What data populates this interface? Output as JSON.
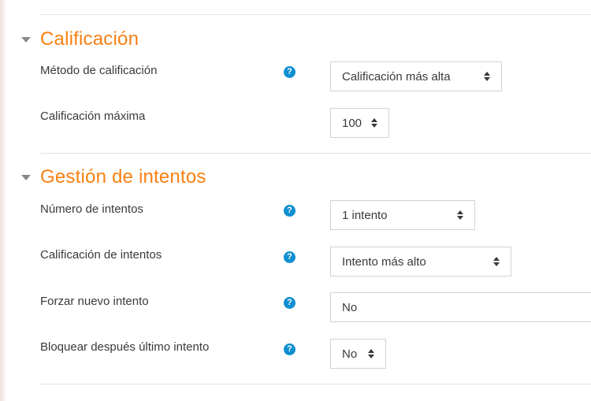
{
  "sections": [
    {
      "title": "Calificación",
      "fields": [
        {
          "label": "Método de calificación",
          "value": "Calificación más alta",
          "has_help": true
        },
        {
          "label": "Calificación máxima",
          "value": "100",
          "has_help": false
        }
      ]
    },
    {
      "title": "Gestión de intentos",
      "fields": [
        {
          "label": "Número de intentos",
          "value": "1 intento",
          "has_help": true
        },
        {
          "label": "Calificación de intentos",
          "value": "Intento más alto",
          "has_help": true
        },
        {
          "label": "Forzar nuevo intento",
          "value": "No",
          "has_help": true
        },
        {
          "label": "Bloquear después último intento",
          "value": "No",
          "has_help": true
        }
      ]
    }
  ],
  "help_icon_glyph": "?",
  "colors": {
    "section_title": "#f98012",
    "help_icon": "#0f8fd0",
    "text": "#373a3c",
    "border": "#cfd3d6"
  }
}
